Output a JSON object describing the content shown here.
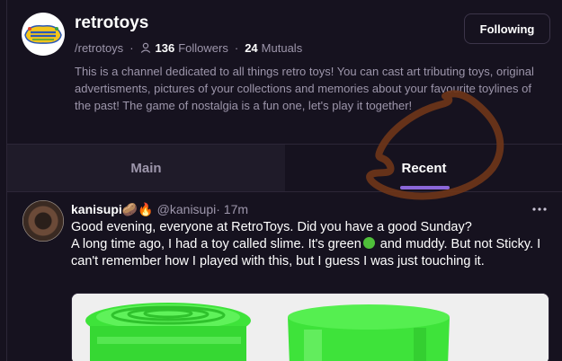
{
  "channel": {
    "name": "retrotoys",
    "handle": "/retrotoys",
    "followers_count": "136",
    "followers_label": "Followers",
    "mutuals_count": "24",
    "mutuals_label": "Mutuals",
    "follow_button_label": "Following",
    "description": "This is a channel dedicated to all things retro toys! You can cast art tributing toys, original advertisments, pictures of your collections and memories about your favourite toylines of the past! The game of nostalgia is a fun one, let's play it together!",
    "avatar_icon": "retrotoys-logo"
  },
  "tabs": [
    {
      "label": "Main",
      "active": false
    },
    {
      "label": "Recent",
      "active": true
    }
  ],
  "post": {
    "author": "kanisupi🥔🔥",
    "handle": "@kanisupi",
    "time": "· 17m",
    "line1": "Good evening, everyone at RetroToys. Did you have a good Sunday?",
    "line2_before": "A long time ago, I had a toy called slime. It's green",
    "line2_after": " and muddy. But not Sticky. I can't remember how I played with this, but I guess I was just touching it.",
    "more_icon": "ellipsis-icon"
  },
  "colors": {
    "background": "#16121f",
    "accent": "#8b67d8",
    "muted_text": "#9d96ab",
    "annotation": "#7a3a1e"
  }
}
